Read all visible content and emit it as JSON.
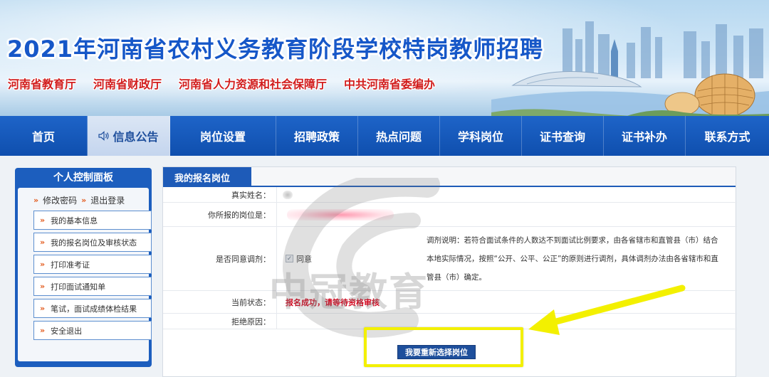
{
  "banner": {
    "title": "2021年河南省农村义务教育阶段学校特岗教师招聘",
    "departments": [
      "河南省教育厅",
      "河南省财政厅",
      "河南省人力资源和社会保障厅",
      "中共河南省委编办"
    ]
  },
  "nav": {
    "items": [
      {
        "label": "首页",
        "width": 123
      },
      {
        "label": "信息公告",
        "width": 116,
        "active": true
      },
      {
        "label": "岗位设置",
        "width": 149
      },
      {
        "label": "招聘政策",
        "width": 115
      },
      {
        "label": "热点问题",
        "width": 115
      },
      {
        "label": "学科岗位",
        "width": 115
      },
      {
        "label": "证书查询",
        "width": 115
      },
      {
        "label": "证书补办",
        "width": 115
      },
      {
        "label": "联系方式",
        "width": 117
      }
    ]
  },
  "panel": {
    "title": "个人控制面板",
    "quick_links": [
      "修改密码",
      "退出登录"
    ],
    "menu": [
      "我的基本信息",
      "我的报名岗位及审核状态",
      "打印准考证",
      "打印面试通知单",
      "笔试，面试成绩体检结果",
      "安全退出"
    ]
  },
  "main": {
    "tab": "我的报名岗位",
    "fields": {
      "name_label": "真实姓名：",
      "position_label": "你所报的岗位是：",
      "adjust_label": "是否同意调剂：",
      "agree_text": "同意",
      "adjust_note": "调剂说明：若符合面试条件的人数达不到面试比例要求，由各省辖市和直管县（市）结合本地实际情况，按照“公开、公平、公正”的原则进行调剂，具体调剂办法由各省辖市和直管县（市）确定。",
      "status_label": "当前状态：",
      "status_value": "报名成功，请等待资格审核",
      "reject_label": "拒绝原因："
    },
    "reselect_button": "我要重新选择岗位"
  },
  "watermark": "中冠教育",
  "colors": {
    "nav_blue": "#0f4fae",
    "title_blue": "#1657c8",
    "dept_red": "#d11d1d",
    "status_red": "#d0021b",
    "highlight_yellow": "#f3f000"
  }
}
